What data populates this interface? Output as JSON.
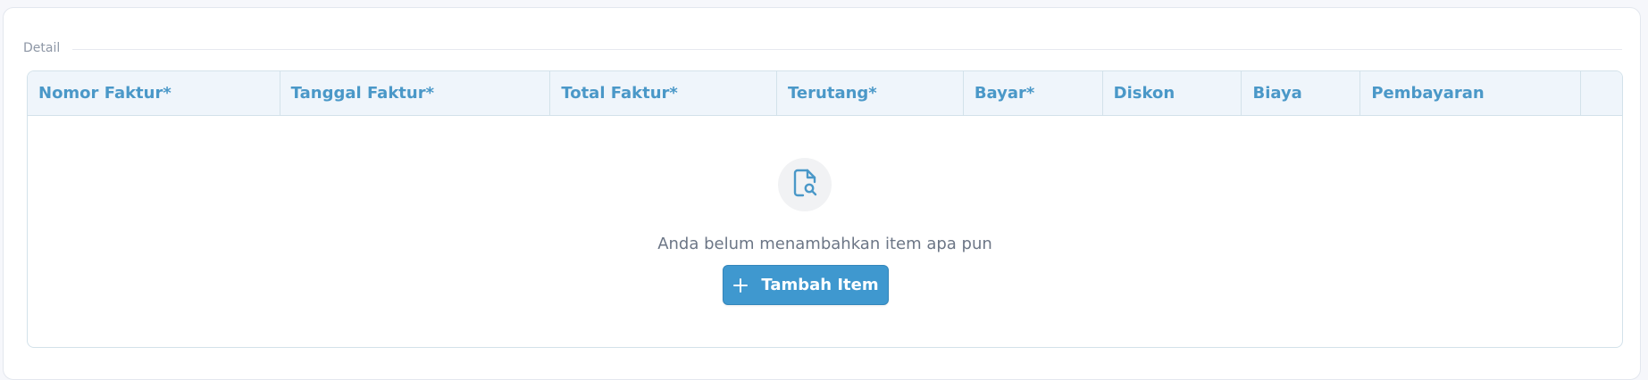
{
  "section": {
    "label": "Detail"
  },
  "table": {
    "columns": [
      "Nomor Faktur*",
      "Tanggal Faktur*",
      "Total Faktur*",
      "Terutang*",
      "Bayar*",
      "Diskon",
      "Biaya",
      "Pembayaran",
      ""
    ],
    "empty_message": "Anda belum menambahkan item apa pun",
    "add_button_label": "Tambah Item"
  },
  "colors": {
    "accent": "#3f98cf",
    "header_text": "#4a98c8",
    "header_bg": "#eff5fb"
  },
  "icons": {
    "empty_state": "document-search-icon",
    "add": "plus-icon"
  }
}
